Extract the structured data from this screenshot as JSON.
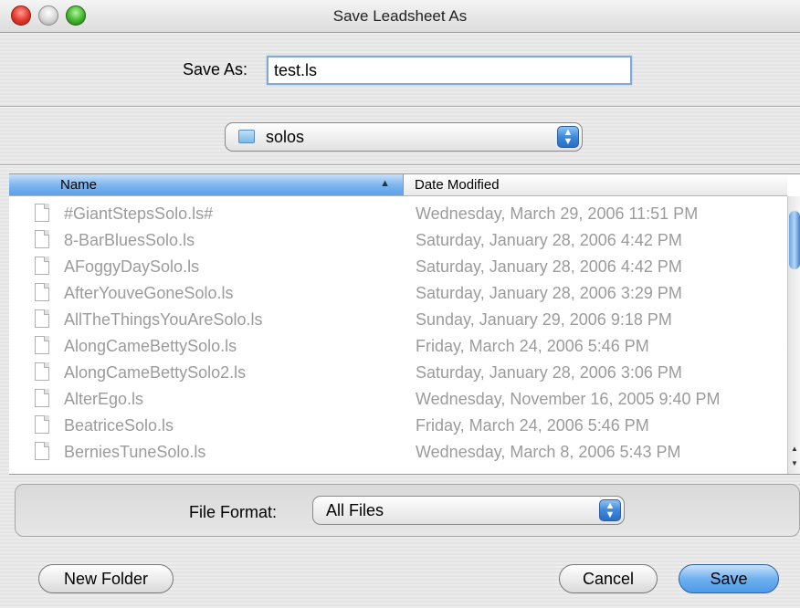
{
  "window": {
    "title": "Save Leadsheet As"
  },
  "save_as": {
    "label": "Save As:",
    "value": "test.ls"
  },
  "location": {
    "folder": "solos"
  },
  "columns": {
    "name": "Name",
    "date": "Date Modified"
  },
  "files": [
    {
      "name": "#GiantStepsSolo.ls#",
      "date": "Wednesday, March 29, 2006 11:51 PM"
    },
    {
      "name": "8-BarBluesSolo.ls",
      "date": "Saturday, January 28, 2006 4:42 PM"
    },
    {
      "name": "AFoggyDaySolo.ls",
      "date": "Saturday, January 28, 2006 4:42 PM"
    },
    {
      "name": "AfterYouveGoneSolo.ls",
      "date": "Saturday, January 28, 2006 3:29 PM"
    },
    {
      "name": "AllTheThingsYouAreSolo.ls",
      "date": "Sunday, January 29, 2006 9:18 PM"
    },
    {
      "name": "AlongCameBettySolo.ls",
      "date": "Friday, March 24, 2006 5:46 PM"
    },
    {
      "name": "AlongCameBettySolo2.ls",
      "date": "Saturday, January 28, 2006 3:06 PM"
    },
    {
      "name": "AlterEgo.ls",
      "date": "Wednesday, November 16, 2005 9:40 PM"
    },
    {
      "name": "BeatriceSolo.ls",
      "date": "Friday, March 24, 2006 5:46 PM"
    },
    {
      "name": "BerniesTuneSolo.ls",
      "date": "Wednesday, March 8, 2006 5:43 PM"
    }
  ],
  "file_format": {
    "label": "File Format:",
    "value": "All Files"
  },
  "buttons": {
    "new_folder": "New Folder",
    "cancel": "Cancel",
    "save": "Save"
  },
  "colors": {
    "accent": "#5ba1e8",
    "disabled_text": "#9b9b9b"
  }
}
